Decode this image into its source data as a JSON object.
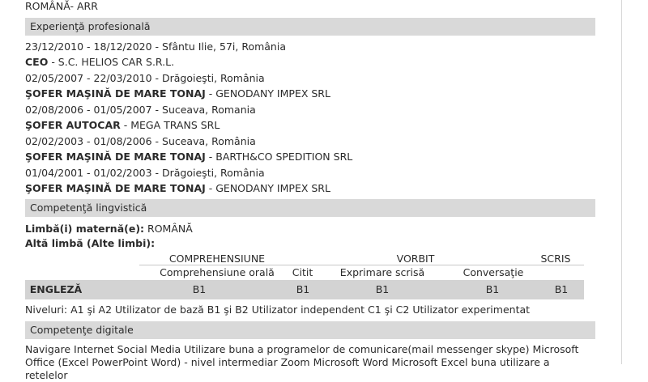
{
  "top_line": "ROMÂNĂ- ARR",
  "experience": {
    "title": "Experienţă profesională",
    "entries": [
      {
        "period": "23/12/2010 - 18/12/2020 - Sfântu Ilie, 57i, România",
        "role": "CEO",
        "company": " - S.C. HELIOS CAR S.R.L."
      },
      {
        "period": "02/05/2007 - 22/03/2010 - Drăgoieşti, România",
        "role": "ŞOFER MAŞINĂ DE MARE TONAJ",
        "company": " - GENODANY IMPEX SRL"
      },
      {
        "period": "02/08/2006 - 01/05/2007 - Suceava, Romania",
        "role": "ŞOFER AUTOCAR",
        "company": " - MEGA TRANS SRL"
      },
      {
        "period": "02/02/2003 - 01/08/2006 - Suceava, România",
        "role": "ŞOFER MAŞINĂ DE MARE TONAJ",
        "company": " - BARTH&CO SPEDITION SRL"
      },
      {
        "period": "01/04/2001 - 01/02/2003 - Drăgoieşti, România",
        "role": "ŞOFER MAŞINĂ DE MARE TONAJ",
        "company": " - GENODANY IMPEX SRL"
      }
    ]
  },
  "languages": {
    "title": "Competenţă lingvistică",
    "mother_label": "Limbă(i) maternă(e):",
    "mother_value": " ROMÂNĂ",
    "other_label": "Altă limbă (Alte limbi):",
    "groups": [
      "COMPREHENSIUNE",
      "VORBIT",
      "SCRIS"
    ],
    "subheaders": [
      "Comprehensiune orală",
      "Citit",
      "Exprimare scrisă",
      "Conversaţie"
    ],
    "rows": [
      {
        "name": "ENGLEZĂ",
        "values": [
          "B1",
          "B1",
          "B1",
          "B1",
          "B1"
        ]
      }
    ],
    "levels_note": "Niveluri: A1 şi A2 Utilizator de bază B1 şi B2 Utilizator independent C1 şi C2 Utilizator experimentat"
  },
  "digital": {
    "title": "Competenţe digitale",
    "text": "Navigare Internet Social Media Utilizare buna a programelor de comunicare(mail messenger skype) Microsoft Office (Excel PowerPoint Word) - nivel intermediar Zoom Microsoft Word Microsoft Excel buna utilizare a retelelor"
  }
}
